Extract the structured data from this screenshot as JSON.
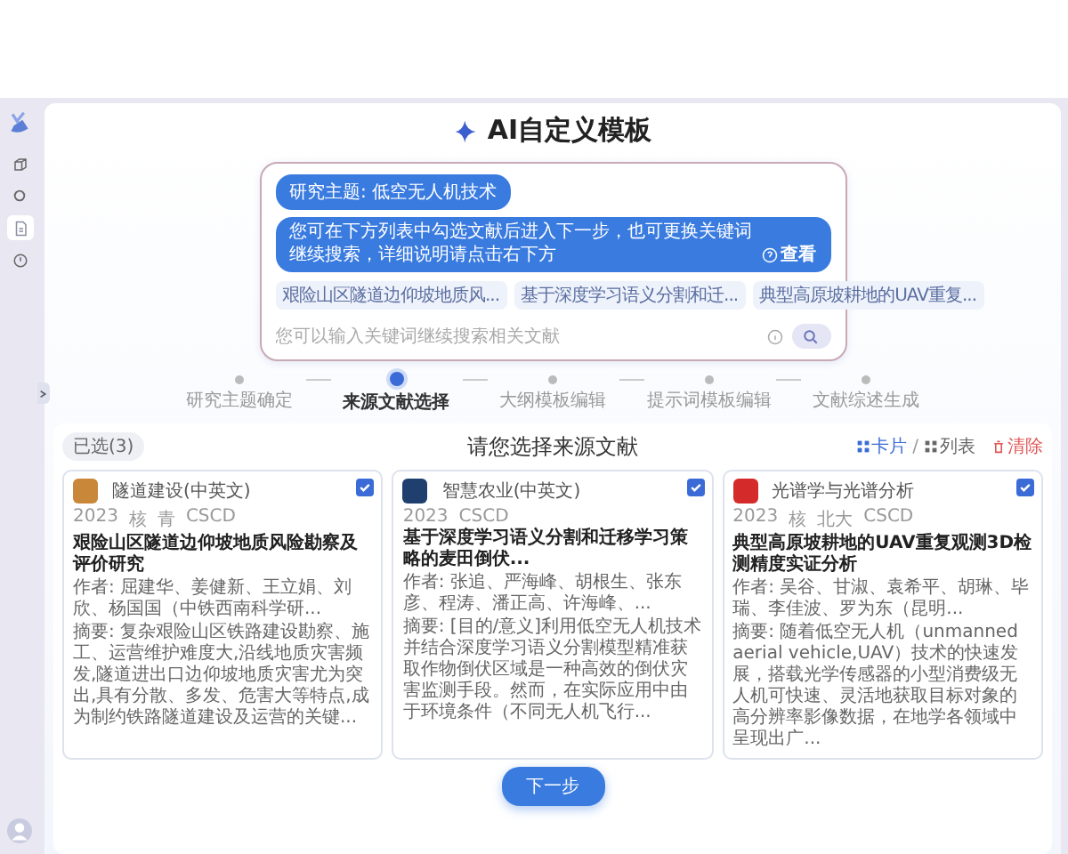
{
  "sidebar": {
    "items": [
      {
        "kind": "cube",
        "selected": false
      },
      {
        "kind": "gear",
        "selected": false
      },
      {
        "kind": "document",
        "selected": true
      },
      {
        "kind": "clock",
        "selected": false
      }
    ]
  },
  "header": {
    "title": "AI自定义模板"
  },
  "chat": {
    "messages": [
      "研究主题: 低空无人机技术",
      "您可在下方列表中勾选文献后进入下一步，也可更换关键词继续搜索，详细说明请点击右下方"
    ],
    "help_link": "查看",
    "chips": [
      "艰险山区隧道边仰坡地质风...",
      "基于深度学习语义分割和迁...",
      "典型高原坡耕地的UAV重复..."
    ],
    "input": {
      "placeholder": "您可以输入关键词继续搜索相关文献"
    }
  },
  "steps": [
    {
      "label": "研究主题确定",
      "selected": false
    },
    {
      "label": "来源文献选择",
      "selected": true
    },
    {
      "label": "大纲模板编辑",
      "selected": false
    },
    {
      "label": "提示词模板编辑",
      "selected": false
    },
    {
      "label": "文献综述生成",
      "selected": false
    }
  ],
  "section": {
    "selected_count": "已选(3)",
    "title": "请您选择来源文献",
    "separator": "/",
    "views": [
      {
        "label": "卡片",
        "selected": true
      },
      {
        "label": "列表",
        "selected": false
      }
    ],
    "clear": "清除"
  },
  "cards": [
    {
      "checked": true,
      "color": "#c9873a",
      "journal": "隧道建设(中英文)",
      "meta": [
        "2023",
        "核",
        "青",
        "CSCD"
      ],
      "title": "艰险山区隧道边仰坡地质风险勘察及评价研究",
      "authors": "作者: 屈建华、姜健新、王立娟、刘欣、杨国国（中铁西南科学研...",
      "abstract": "摘要: 复杂艰险山区铁路建设勘察、施工、运营维护难度大,沿线地质灾害频发,隧道进出口边仰坡地质灾害尤为突出,具有分散、多发、危害大等特点,成为制约铁路隧道建设及运营的关键..."
    },
    {
      "checked": true,
      "color": "#1f3f6e",
      "journal": "智慧农业(中英文)",
      "meta": [
        "2023",
        "CSCD"
      ],
      "title": "基于深度学习语义分割和迁移学习策略的麦田倒伏...",
      "authors": "作者: 张追、严海峰、胡根生、张东彦、程涛、潘正高、许海峰、...",
      "abstract": "摘要: [目的/意义]利用低空无人机技术并结合深度学习语义分割模型精准获取作物倒伏区域是一种高效的倒伏灾害监测手段。然而，在实际应用中由于环境条件（不同无人机飞行..."
    },
    {
      "checked": true,
      "color": "#d42a2a",
      "journal": "光谱学与光谱分析",
      "meta": [
        "2023",
        "核",
        "北大",
        "CSCD"
      ],
      "title": "典型高原坡耕地的UAV重复观测3D检测精度实证分析",
      "authors": "作者: 吴谷、甘淑、袁希平、胡琳、毕瑞、李佳波、罗为东（昆明...",
      "abstract": "摘要: 随着低空无人机（unmanned aerial vehicle,UAV）技术的快速发展，搭载光学传感器的小型消费级无人机可快速、灵活地获取目标对象的高分辨率影像数据，在地学各领域中呈现出广..."
    }
  ],
  "next_button": "下一步"
}
